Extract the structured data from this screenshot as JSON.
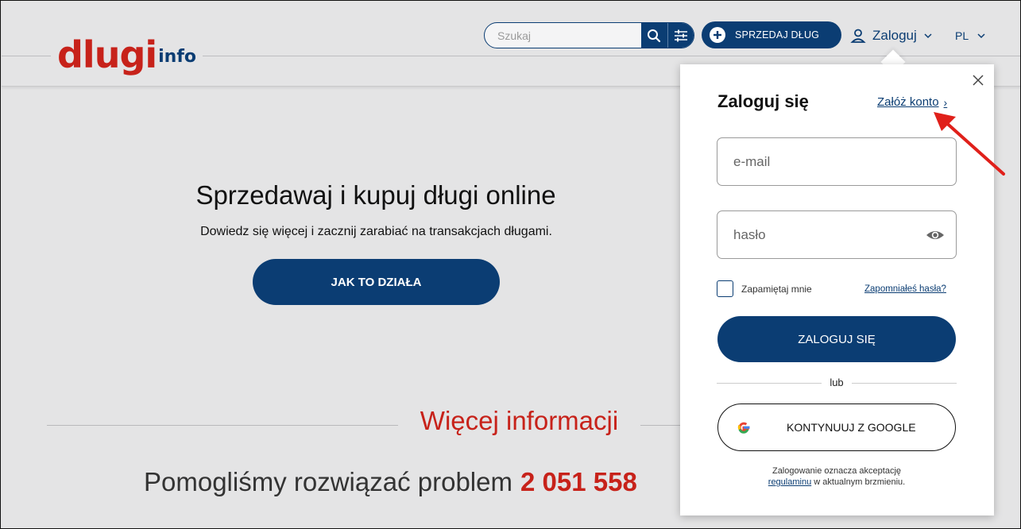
{
  "header": {
    "logo_main": "dlugi",
    "logo_sub": "info",
    "search_placeholder": "Szukaj",
    "search_icon": "search-icon",
    "filter_icon": "sliders-icon",
    "sell_button": "SPRZEDAJ DŁUG",
    "login_label": "Zaloguj",
    "language": "PL"
  },
  "hero": {
    "title": "Sprzedawaj i kupuj długi online",
    "subtitle": "Dowiedz się więcej i zacznij zarabiać na transakcjach długami.",
    "cta": "JAK TO DZIAŁA"
  },
  "more_info": {
    "title": "Więcej informacji",
    "helped_text": "Pomogliśmy rozwiązać problem",
    "helped_count": "2 051 558"
  },
  "login_popover": {
    "title": "Zaloguj się",
    "register_link": "Załóż konto",
    "email_placeholder": "e-mail",
    "password_placeholder": "hasło",
    "remember_me": "Zapamiętaj mnie",
    "forgot_password": "Zapomniałeś hasła?",
    "submit": "ZALOGUJ SIĘ",
    "or": "lub",
    "google_button": "KONTYNUUJ Z GOOGLE",
    "terms_line1": "Zalogowanie oznacza akceptację",
    "terms_link": "regulaminu",
    "terms_line2": "w aktualnym brzmieniu."
  },
  "colors": {
    "brand_red": "#c7221a",
    "brand_navy": "#0b3d73",
    "page_bg": "#e4e4e5",
    "annotation_arrow": "#e0201a"
  }
}
